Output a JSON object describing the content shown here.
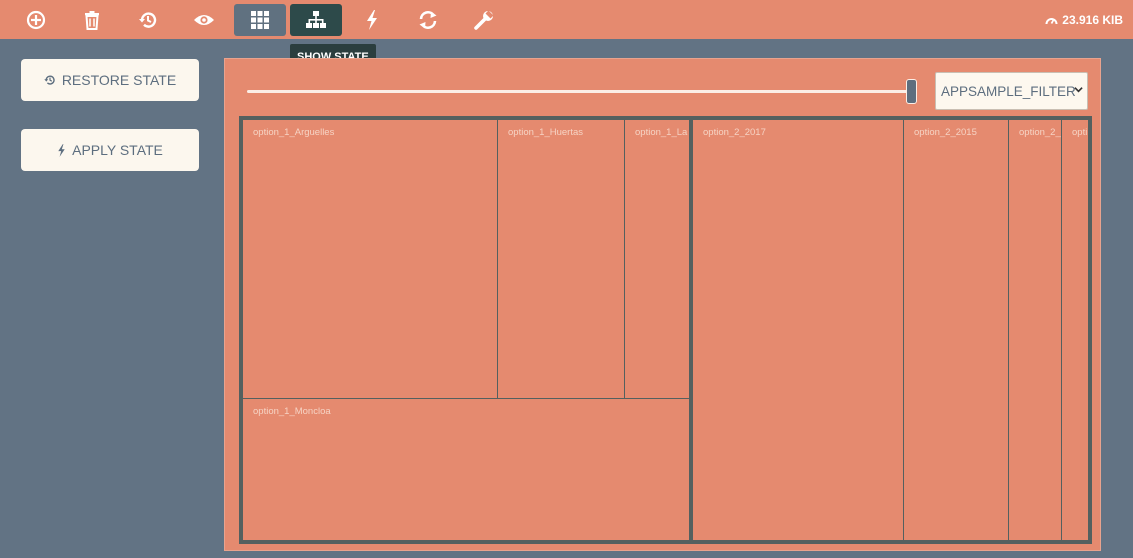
{
  "toolbar": {
    "buttons": [
      {
        "icon": "crosshair-icon"
      },
      {
        "icon": "trash-icon"
      },
      {
        "icon": "history-icon"
      },
      {
        "icon": "eye-icon"
      },
      {
        "icon": "grid-icon"
      },
      {
        "icon": "sitemap-icon"
      },
      {
        "icon": "bolt-icon"
      },
      {
        "icon": "refresh-icon"
      },
      {
        "icon": "wrench-icon"
      }
    ],
    "memory": "23.916 KIB"
  },
  "tooltip": "SHOW STATE",
  "sidebar": {
    "restore_label": "RESTORE STATE",
    "apply_label": "APPLY STATE"
  },
  "filter": {
    "selected": "APPSAMPLE_FILTER"
  },
  "slider": {
    "value": 1.0
  },
  "treemap": {
    "cells": [
      "option_1_Arguelles",
      "option_1_Huertas",
      "option_1_La",
      "option_1_Moncloa",
      "option_2_2017",
      "option_2_2015",
      "option_2_",
      "opti"
    ]
  },
  "colors": {
    "accent": "#e58a6f",
    "background": "#627384",
    "dark": "#2d4a4a"
  }
}
